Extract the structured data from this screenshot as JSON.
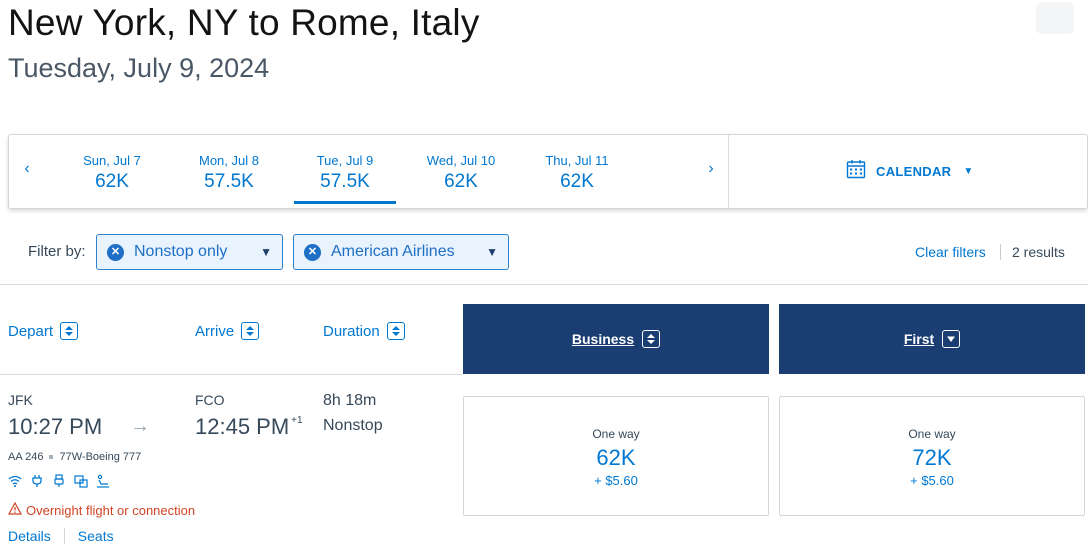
{
  "header": {
    "title": "New York, NY to Rome, Italy",
    "subtitle": "Tuesday, July 9, 2024"
  },
  "date_bar": {
    "prev_arrow": "‹",
    "next_arrow": "›",
    "dates": [
      {
        "label": "Sun, Jul 7",
        "price": "62K",
        "selected": false
      },
      {
        "label": "Mon, Jul 8",
        "price": "57.5K",
        "selected": false
      },
      {
        "label": "Tue, Jul 9",
        "price": "57.5K",
        "selected": true
      },
      {
        "label": "Wed, Jul 10",
        "price": "62K",
        "selected": false
      },
      {
        "label": "Thu, Jul 11",
        "price": "62K",
        "selected": false
      }
    ],
    "calendar_label": "CALENDAR",
    "calendar_caret": "▼"
  },
  "filters": {
    "label": "Filter by:",
    "chips": [
      {
        "text": "Nonstop only",
        "remove": "✕",
        "caret": "▼"
      },
      {
        "text": "American Airlines",
        "remove": "✕",
        "caret": "▼"
      }
    ],
    "clear_label": "Clear filters",
    "results": "2 results"
  },
  "columns": {
    "depart": "Depart",
    "arrive": "Arrive",
    "duration": "Duration",
    "business": "Business",
    "first": "First"
  },
  "flight": {
    "depart_airport": "JFK",
    "depart_time": "10:27 PM",
    "arrow": "→",
    "arrive_airport": "FCO",
    "arrive_time": "12:45 PM",
    "day_offset": "+1",
    "duration": "8h 18m",
    "stops": "Nonstop",
    "flight_number": "AA 246",
    "aircraft": "77W-Boeing 777",
    "amenities": [
      "wifi-icon",
      "power-icon",
      "usb-icon",
      "entertainment-icon",
      "lie-flat-seat-icon"
    ],
    "warning": "Overnight flight or connection",
    "details_link": "Details",
    "seats_link": "Seats"
  },
  "fares": {
    "business": {
      "label": "One way",
      "miles": "62K",
      "tax": "+ $5.60"
    },
    "first": {
      "label": "One way",
      "miles": "72K",
      "tax": "+ $5.60"
    }
  },
  "colors": {
    "accent": "#0078d2",
    "cabin_header": "#1a3e72",
    "warning": "#d14424",
    "chip_bg": "#e9f3fd"
  }
}
